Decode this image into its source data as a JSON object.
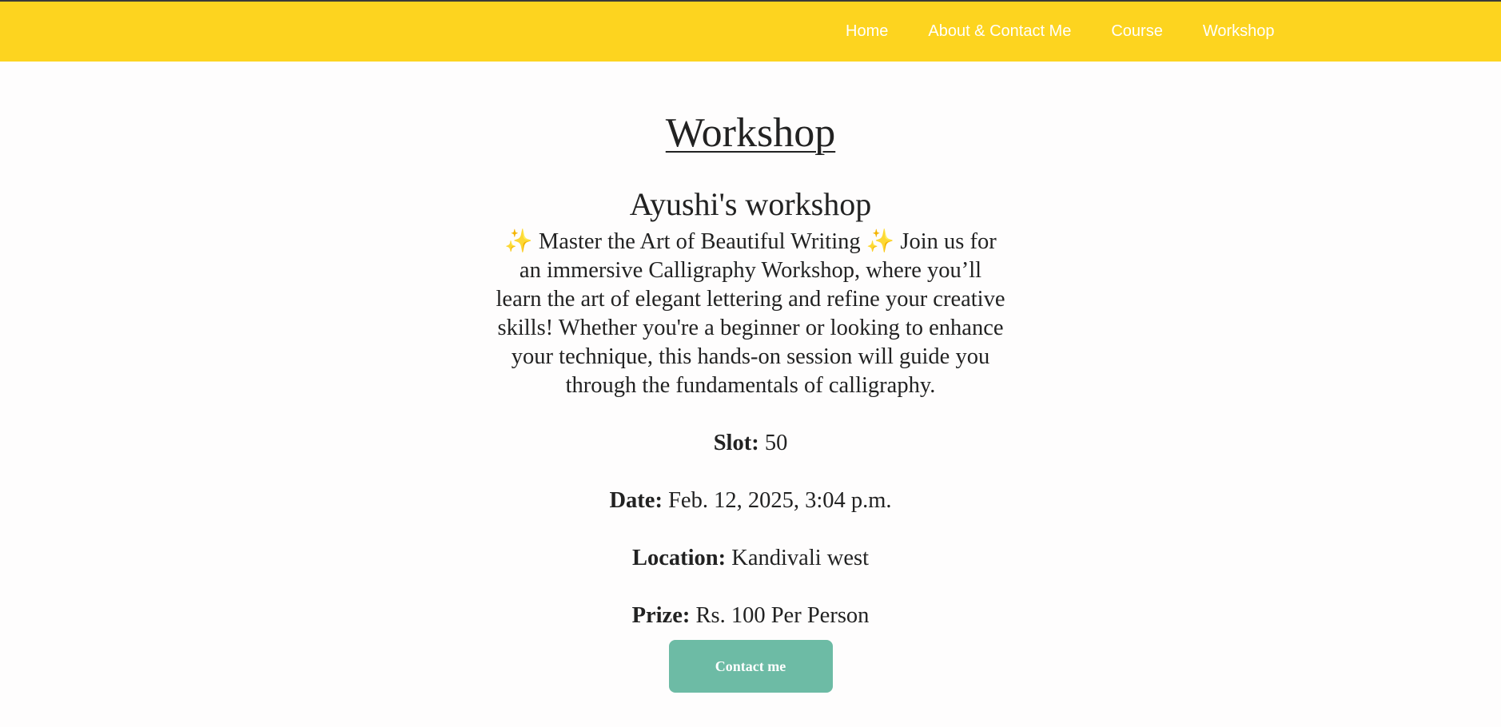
{
  "nav": {
    "items": [
      {
        "label": "Home"
      },
      {
        "label": "About & Contact Me"
      },
      {
        "label": "Course"
      },
      {
        "label": "Workshop"
      }
    ]
  },
  "page": {
    "title": "Workshop"
  },
  "workshop": {
    "name": "Ayushi's workshop",
    "sparkle": "✨",
    "description_part1": "Master the Art of Beautiful Writing",
    "description_part2": "Join us for an immersive Calligraphy Workshop, where you’ll learn the art of elegant lettering and refine your creative skills! Whether you're a beginner or looking to enhance your technique, this hands-on session will guide you through the fundamentals of calligraphy.",
    "slot_label": "Slot:",
    "slot_value": "50",
    "date_label": "Date:",
    "date_value": "Feb. 12, 2025, 3:04 p.m.",
    "location_label": "Location:",
    "location_value": "Kandivali west",
    "prize_label": "Prize:",
    "prize_value": "Rs. 100 Per Person",
    "contact_button_label": "Contact me"
  },
  "colors": {
    "navbar_bg": "#fdd41f",
    "nav_text": "#ffffff",
    "button_bg": "#6dbba5",
    "text": "#222222",
    "sparkle": "#f6c34a"
  }
}
